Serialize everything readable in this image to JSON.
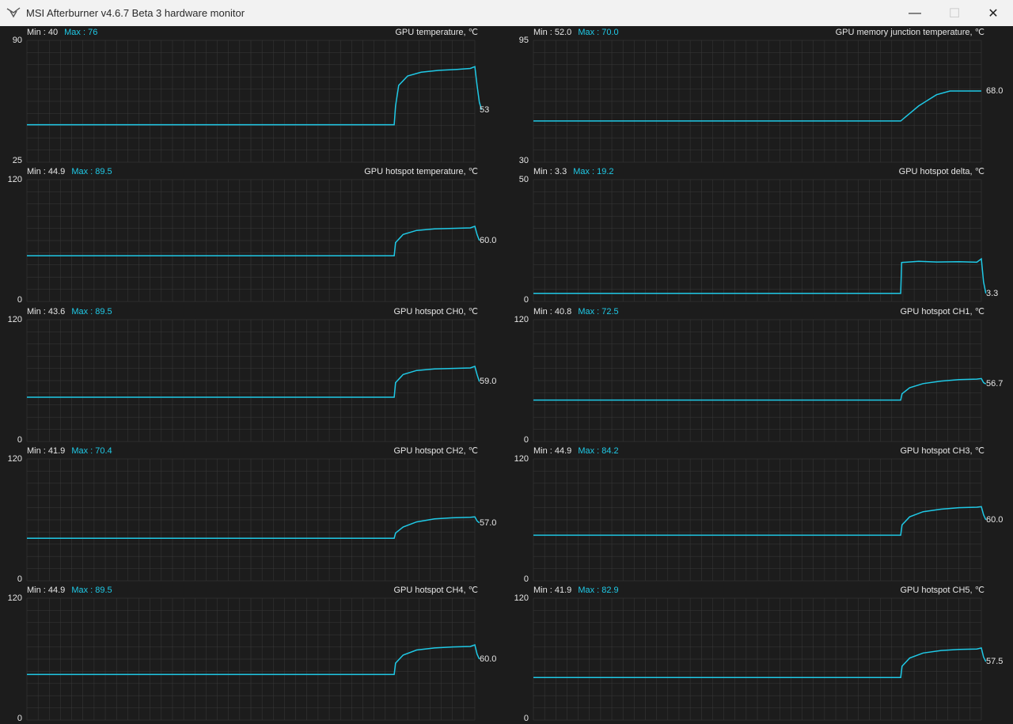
{
  "window": {
    "title": "MSI Afterburner v4.6.7 Beta 3 hardware monitor",
    "min_glyph": "—",
    "max_glyph": "☐",
    "close_glyph": "✕",
    "app_icon": "afterburner-plane-icon"
  },
  "colors": {
    "line": "#1fc9e6",
    "grid": "#3a3a3a",
    "background": "#1c1c1c",
    "accent": "#1fc9e6"
  },
  "panels": [
    {
      "title": "GPU temperature, ℃",
      "min_text": "Min : 40",
      "max_text": "Max : 76",
      "y_max": "90",
      "y_min": "25",
      "current": "53",
      "ymin_v": 25,
      "ymax_v": 90,
      "series": [
        [
          0,
          45
        ],
        [
          82,
          45
        ],
        [
          82.3,
          55
        ],
        [
          83,
          66
        ],
        [
          85,
          71
        ],
        [
          88,
          73
        ],
        [
          92,
          74
        ],
        [
          96,
          74.5
        ],
        [
          99,
          75
        ],
        [
          100,
          76
        ],
        [
          100.5,
          66
        ],
        [
          101,
          57
        ],
        [
          101.5,
          53
        ]
      ]
    },
    {
      "title": "GPU memory junction temperature, ℃",
      "min_text": "Min : 52.0",
      "max_text": "Max : 70.0",
      "y_max": "95",
      "y_min": "30",
      "current": "68.0",
      "ymin_v": 30,
      "ymax_v": 95,
      "series": [
        [
          0,
          52
        ],
        [
          82,
          52
        ],
        [
          84,
          56
        ],
        [
          86,
          60
        ],
        [
          88,
          63
        ],
        [
          90,
          66
        ],
        [
          93,
          68
        ],
        [
          97,
          68
        ],
        [
          99,
          68
        ],
        [
          100,
          68
        ]
      ]
    },
    {
      "title": "GPU hotspot temperature, ℃",
      "min_text": "Min : 44.9",
      "max_text": "Max : 89.5",
      "y_max": "120",
      "y_min": "0",
      "current": "60.0",
      "ymin_v": 0,
      "ymax_v": 120,
      "series": [
        [
          0,
          45
        ],
        [
          82,
          45
        ],
        [
          82.3,
          58
        ],
        [
          84,
          66
        ],
        [
          87,
          70
        ],
        [
          91,
          71.5
        ],
        [
          95,
          72
        ],
        [
          99,
          72.5
        ],
        [
          100,
          74
        ],
        [
          100.5,
          66
        ],
        [
          101,
          60
        ]
      ]
    },
    {
      "title": "GPU hotspot delta, ℃",
      "min_text": "Min : 3.3",
      "max_text": "Max : 19.2",
      "y_max": "50",
      "y_min": "0",
      "current": "3.3",
      "ymin_v": 0,
      "ymax_v": 50,
      "series": [
        [
          0,
          3.3
        ],
        [
          82,
          3.3
        ],
        [
          82.2,
          16
        ],
        [
          86,
          16.5
        ],
        [
          90,
          16.2
        ],
        [
          95,
          16.3
        ],
        [
          99,
          16.1
        ],
        [
          100,
          17.5
        ],
        [
          100.5,
          8
        ],
        [
          101,
          3.3
        ]
      ]
    },
    {
      "title": "GPU hotspot CH0, ℃",
      "min_text": "Min : 43.6",
      "max_text": "Max : 89.5",
      "y_max": "120",
      "y_min": "0",
      "current": "59.0",
      "ymin_v": 0,
      "ymax_v": 120,
      "series": [
        [
          0,
          43.6
        ],
        [
          82,
          43.6
        ],
        [
          82.3,
          58
        ],
        [
          84,
          66
        ],
        [
          87,
          70
        ],
        [
          91,
          71.5
        ],
        [
          95,
          72
        ],
        [
          99,
          72.5
        ],
        [
          100,
          74
        ],
        [
          100.5,
          66
        ],
        [
          101,
          59
        ]
      ]
    },
    {
      "title": "GPU hotspot CH1, ℃",
      "min_text": "Min : 40.8",
      "max_text": "Max : 72.5",
      "y_max": "120",
      "y_min": "0",
      "current": "56.7",
      "ymin_v": 0,
      "ymax_v": 120,
      "series": [
        [
          0,
          40.8
        ],
        [
          82,
          40.8
        ],
        [
          82.3,
          47
        ],
        [
          84,
          53
        ],
        [
          87,
          57
        ],
        [
          91,
          59.5
        ],
        [
          95,
          61
        ],
        [
          99,
          61.5
        ],
        [
          100,
          62
        ],
        [
          100.5,
          58
        ],
        [
          101,
          56.7
        ]
      ]
    },
    {
      "title": "GPU hotspot CH2, ℃",
      "min_text": "Min : 41.9",
      "max_text": "Max : 70.4",
      "y_max": "120",
      "y_min": "0",
      "current": "57.0",
      "ymin_v": 0,
      "ymax_v": 120,
      "series": [
        [
          0,
          41.9
        ],
        [
          82,
          41.9
        ],
        [
          82.3,
          47
        ],
        [
          84,
          53
        ],
        [
          87,
          58
        ],
        [
          91,
          61
        ],
        [
          95,
          62
        ],
        [
          99,
          62.5
        ],
        [
          100,
          63
        ],
        [
          100.5,
          59
        ],
        [
          101,
          57
        ]
      ]
    },
    {
      "title": "GPU hotspot CH3, ℃",
      "min_text": "Min : 44.9",
      "max_text": "Max : 84.2",
      "y_max": "120",
      "y_min": "0",
      "current": "60.0",
      "ymin_v": 0,
      "ymax_v": 120,
      "series": [
        [
          0,
          44.9
        ],
        [
          82,
          44.9
        ],
        [
          82.3,
          55
        ],
        [
          84,
          63
        ],
        [
          87,
          68
        ],
        [
          91,
          70.5
        ],
        [
          95,
          72
        ],
        [
          99,
          72.5
        ],
        [
          100,
          73
        ],
        [
          100.5,
          65
        ],
        [
          101,
          60
        ]
      ]
    },
    {
      "title": "GPU hotspot CH4, ℃",
      "min_text": "Min : 44.9",
      "max_text": "Max : 89.5",
      "y_max": "120",
      "y_min": "0",
      "current": "60.0",
      "ymin_v": 0,
      "ymax_v": 120,
      "series": [
        [
          0,
          44.9
        ],
        [
          82,
          44.9
        ],
        [
          82.3,
          56
        ],
        [
          84,
          64
        ],
        [
          87,
          69
        ],
        [
          91,
          71
        ],
        [
          95,
          72
        ],
        [
          99,
          72.5
        ],
        [
          100,
          74
        ],
        [
          100.5,
          65
        ],
        [
          101,
          60
        ]
      ]
    },
    {
      "title": "GPU hotspot CH5, ℃",
      "min_text": "Min : 41.9",
      "max_text": "Max : 82.9",
      "y_max": "120",
      "y_min": "0",
      "current": "57.5",
      "ymin_v": 0,
      "ymax_v": 120,
      "series": [
        [
          0,
          41.9
        ],
        [
          82,
          41.9
        ],
        [
          82.3,
          53
        ],
        [
          84,
          61
        ],
        [
          87,
          66
        ],
        [
          91,
          68.5
        ],
        [
          95,
          69.5
        ],
        [
          99,
          70
        ],
        [
          100,
          71
        ],
        [
          100.5,
          62
        ],
        [
          101,
          57.5
        ]
      ]
    }
  ]
}
